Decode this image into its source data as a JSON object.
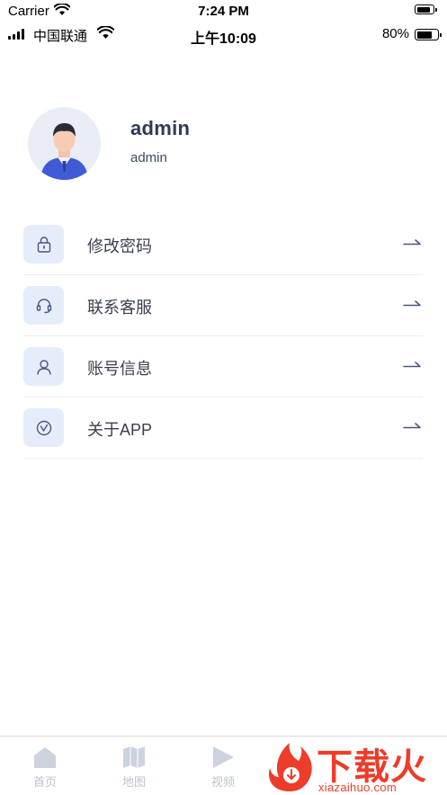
{
  "simulator_bar": {
    "carrier": "Carrier",
    "time": "7:24 PM"
  },
  "status_bar": {
    "carrier": "中国联通",
    "time": "上午10:09",
    "battery_percent": "80%",
    "battery_level": 0.8
  },
  "profile": {
    "name": "admin",
    "subtitle": "admin"
  },
  "menu": [
    {
      "label": "修改密码",
      "icon": "lock-icon"
    },
    {
      "label": "联系客服",
      "icon": "headset-icon"
    },
    {
      "label": "账号信息",
      "icon": "user-icon"
    },
    {
      "label": "关于APP",
      "icon": "check-circle-icon"
    }
  ],
  "tabs": [
    {
      "label": "首页",
      "icon": "home-icon"
    },
    {
      "label": "地图",
      "icon": "map-icon"
    },
    {
      "label": "视频",
      "icon": "play-icon"
    }
  ],
  "watermark": {
    "text": "下载火",
    "url": "xiazaihuo.com"
  },
  "colors": {
    "icon_box": "#e6edfa",
    "icon_stroke": "#4a5680",
    "tab_inactive": "#bcc3cf",
    "watermark": "#ee3c2a",
    "name_text": "#2e3a55"
  }
}
